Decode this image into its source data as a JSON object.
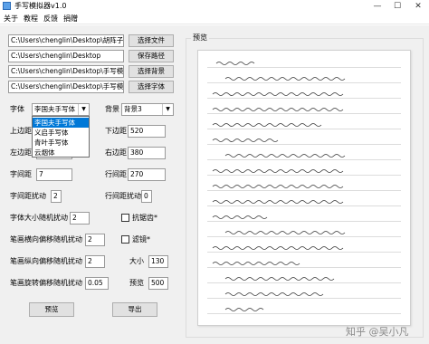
{
  "window": {
    "title": "手写模拟器v1.0",
    "controls": {
      "minimize": "—",
      "maximize": "☐",
      "close": "✕"
    }
  },
  "menu": [
    "关于",
    "教程",
    "反馈",
    "捐赠"
  ],
  "paths": [
    {
      "value": "C:\\Users\\chenglin\\Desktop\\胡阵子",
      "button": "选择文件"
    },
    {
      "value": "C:\\Users\\chenglin\\Desktop",
      "button": "保存路径"
    },
    {
      "value": "C:\\Users\\chenglin\\Desktop\\手写模",
      "button": "选择背景"
    },
    {
      "value": "C:\\Users\\chenglin\\Desktop\\手写模",
      "button": "选择字体"
    }
  ],
  "font": {
    "label": "字体",
    "selected": "李国夫手写体",
    "options": [
      "李国夫手写体",
      "义启手写体",
      "青叶手写体",
      "云烟体"
    ]
  },
  "background": {
    "label": "背景",
    "selected": "背景3"
  },
  "fields": {
    "top_margin": {
      "label": "上边距",
      "value": ""
    },
    "bottom_margin": {
      "label": "下边距",
      "value": "520"
    },
    "left_margin": {
      "label": "左边距",
      "value": ""
    },
    "right_margin": {
      "label": "右边距",
      "value": "380"
    },
    "char_spacing": {
      "label": "字间距",
      "value": "7"
    },
    "line_spacing": {
      "label": "行间距",
      "value": "270"
    },
    "char_spacing_jitter": {
      "label": "字间距扰动",
      "value": "2"
    },
    "line_spacing_jitter": {
      "label": "行间距扰动",
      "value": "0"
    },
    "font_size_jitter": {
      "label": "字体大小随机扰动",
      "value": "2"
    },
    "stroke_h_offset": {
      "label": "笔画横向偏移随机扰动",
      "value": "2"
    },
    "stroke_v_offset": {
      "label": "笔画纵向偏移随机扰动",
      "value": "2"
    },
    "stroke_rotate": {
      "label": "笔画旋转偏移随机扰动",
      "value": "0.05"
    },
    "size": {
      "label": "大小",
      "value": "130"
    },
    "preview_value": {
      "label": "预览",
      "value": "500"
    }
  },
  "checks": {
    "anti_alias": {
      "label": "抗锯齿*",
      "checked": false
    },
    "filter": {
      "label": "滤镜*",
      "checked": false
    }
  },
  "buttons": {
    "preview": "预览",
    "export": "导出"
  },
  "preview_panel": {
    "title": "预览"
  },
  "watermark": "知乎 @吴小凡"
}
